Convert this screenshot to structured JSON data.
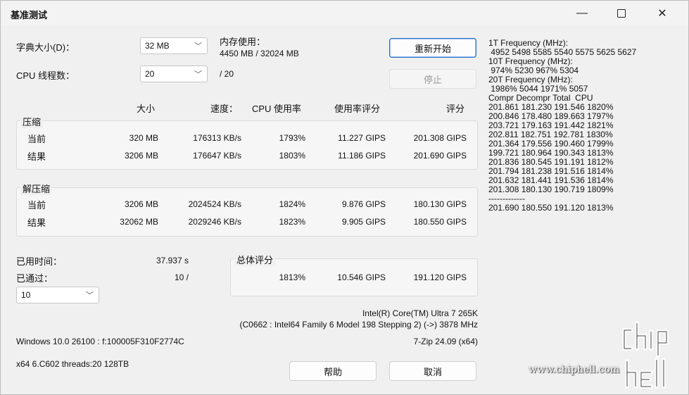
{
  "window": {
    "title": "基准测试",
    "min": "—",
    "close": "✕"
  },
  "dict": {
    "label": "字典大小(D)：",
    "value": "32 MB"
  },
  "threads": {
    "label": "CPU 线程数：",
    "value": "20",
    "max": "/ 20"
  },
  "memory": {
    "label": "内存使用：",
    "value": "4450 MB / 32024 MB"
  },
  "buttons": {
    "restart": "重新开始",
    "stop": "停止",
    "help": "帮助",
    "cancel": "取消"
  },
  "headers": {
    "size": "大小",
    "speed": "速度：",
    "cpu": "CPU 使用率",
    "rating": "使用率评分",
    "score": "评分"
  },
  "compress": {
    "title": "压缩",
    "current": {
      "label": "当前",
      "size": "320 MB",
      "speed": "176313 KB/s",
      "cpu": "1793%",
      "rating": "11.227 GIPS",
      "score": "201.308 GIPS"
    },
    "result": {
      "label": "结果",
      "size": "3206 MB",
      "speed": "176647 KB/s",
      "cpu": "1803%",
      "rating": "11.186 GIPS",
      "score": "201.690 GIPS"
    }
  },
  "decompress": {
    "title": "解压缩",
    "current": {
      "label": "当前",
      "size": "3206 MB",
      "speed": "2024524 KB/s",
      "cpu": "1824%",
      "rating": "9.876 GIPS",
      "score": "180.130 GIPS"
    },
    "result": {
      "label": "结果",
      "size": "32062 MB",
      "speed": "2029246 KB/s",
      "cpu": "1823%",
      "rating": "9.905 GIPS",
      "score": "180.550 GIPS"
    }
  },
  "elapsed": {
    "label": "已用时间：",
    "value": "37.937 s"
  },
  "passed": {
    "label": "已通过：",
    "value": "10 /"
  },
  "passes_select": {
    "value": "10"
  },
  "total": {
    "title": "总体评分",
    "cpu": "1813%",
    "rating": "10.546 GIPS",
    "score": "191.120 GIPS"
  },
  "cpu_info": {
    "line1": "Intel(R) Core(TM) Ultra 7 265K",
    "line2": "(C0662 : Intel64 Family 6 Model 198 Stepping 2) (->) 3878 MHz"
  },
  "sys": {
    "os": "Windows 10.0 26100 : f:100005F310F2774C",
    "version": "7-Zip 24.09 (x64)",
    "arch": "x64 6.C602 threads:20 128TB"
  },
  "freq_log": [
    "1T Frequency (MHz):",
    " 4952 5498 5585 5540 5575 5625 5627",
    "10T Frequency (MHz):",
    " 974% 5230 967% 5304",
    "20T Frequency (MHz):",
    " 1986% 5044 1971% 5057",
    "Compr Decompr Total  CPU",
    "201.861 181.230 191.546 1820%",
    "200.846 178.480 189.663 1797%",
    "203.721 179.163 191.442 1821%",
    "202.811 182.751 192.781 1830%",
    "201.364 179.556 190.460 1799%",
    "199.721 180.964 190.343 1813%",
    "201.836 180.545 191.191 1812%",
    "201.794 181.238 191.516 1814%",
    "201.632 181.441 191.536 1814%",
    "201.308 180.130 190.719 1809%",
    "-------------",
    "201.690 180.550 191.120 1813%"
  ],
  "watermark": {
    "url": "www.chiphell.com",
    "logo": "chip hell"
  },
  "icons": {
    "dropdown": "chevron-down-icon"
  }
}
